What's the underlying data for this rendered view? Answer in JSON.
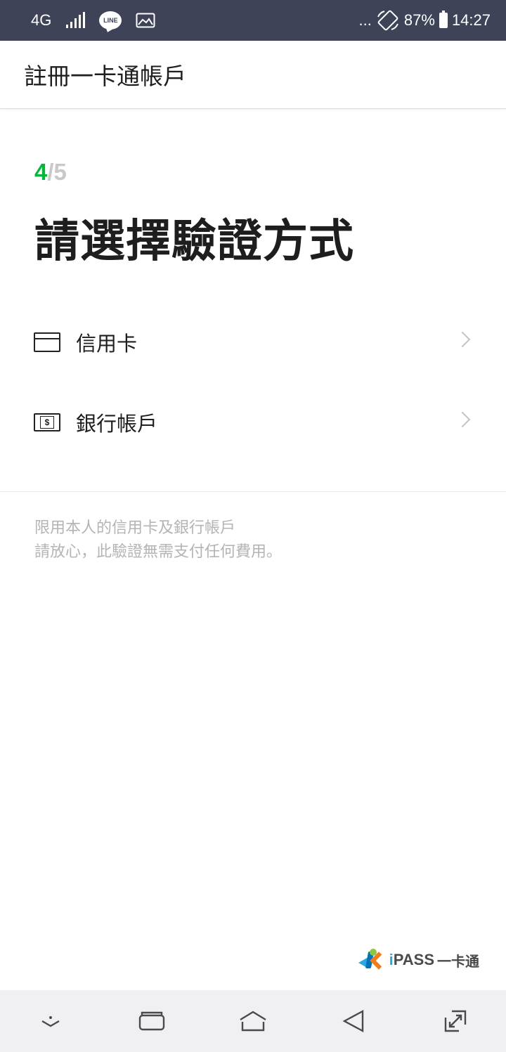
{
  "status_bar": {
    "network": "4G",
    "more": "...",
    "battery": "87%",
    "time": "14:27",
    "icons": [
      "signal-icon",
      "line-app-icon",
      "image-icon",
      "rotate-icon",
      "battery-icon"
    ]
  },
  "header": {
    "title": "註冊一卡通帳戶"
  },
  "step": {
    "current": "4",
    "total": "/5"
  },
  "page_title": "請選擇驗證方式",
  "options": [
    {
      "label": "信用卡",
      "icon": "credit-card-icon"
    },
    {
      "label": "銀行帳戶",
      "icon": "bank-cash-icon"
    }
  ],
  "note": {
    "line1": "限用本人的信用卡及銀行帳戶",
    "line2": "請放心，此驗證無需支付任何費用。"
  },
  "logo": {
    "text_i": "i",
    "text_pass": "PASS",
    "text_cn": "一卡通"
  },
  "nav": [
    "hide-keyboard-icon",
    "recent-apps-icon",
    "home-icon",
    "back-icon",
    "fullscreen-icon"
  ],
  "colors": {
    "status_bar": "#3e4358",
    "step_current": "#07b53b",
    "step_rest": "#c8c8c8",
    "note_text": "#b4b4b4"
  }
}
